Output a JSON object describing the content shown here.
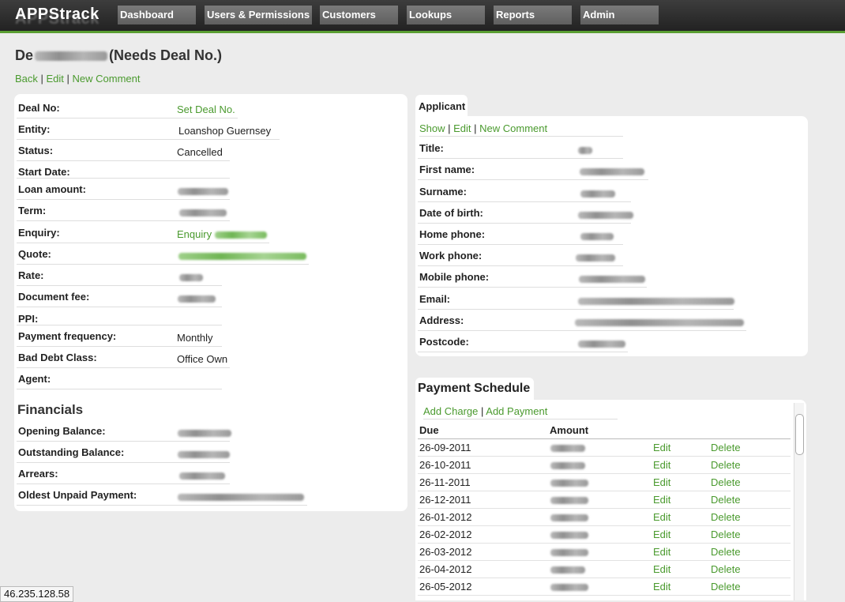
{
  "nav": {
    "logo": "APPStrack",
    "items": [
      "Dashboard",
      "Users & Permissions",
      "Customers",
      "Lookups",
      "Reports",
      "Admin"
    ]
  },
  "page": {
    "title_prefix": "De",
    "title_suffix": "(Needs Deal No.)",
    "actions": {
      "back": "Back",
      "edit": "Edit",
      "new_comment": "New Comment"
    }
  },
  "deal": {
    "labels": {
      "deal_no": "Deal No:",
      "entity": "Entity:",
      "status": "Status:",
      "start_date": "Start Date:",
      "loan_amount": "Loan amount:",
      "term": "Term:",
      "enquiry": "Enquiry:",
      "quote": "Quote:",
      "rate": "Rate:",
      "document_fee": "Document fee:",
      "ppi": "PPI:",
      "payment_frequency": "Payment frequency:",
      "bad_debt_class": "Bad Debt Class:",
      "agent": "Agent:"
    },
    "values": {
      "deal_no": "Set Deal No.",
      "entity": "Loanshop Guernsey",
      "status": "Cancelled",
      "enquiry_prefix": "Enquiry",
      "payment_frequency": "Monthly",
      "bad_debt_class": "Office Own"
    }
  },
  "financials": {
    "heading": "Financials",
    "labels": {
      "opening_balance": "Opening Balance:",
      "outstanding_balance": "Outstanding Balance:",
      "arrears": "Arrears:",
      "oldest_unpaid_payment": "Oldest Unpaid Payment:"
    }
  },
  "applicant": {
    "tab": "Applicant",
    "actions": {
      "show": "Show",
      "edit": "Edit",
      "new_comment": "New Comment"
    },
    "labels": {
      "title": "Title:",
      "first_name": "First name:",
      "surname": "Surname:",
      "date_of_birth": "Date of birth:",
      "home_phone": "Home phone:",
      "work_phone": "Work phone:",
      "mobile_phone": "Mobile phone:",
      "email": "Email:",
      "address": "Address:",
      "postcode": "Postcode:"
    }
  },
  "schedule": {
    "tab": "Payment Schedule",
    "actions": {
      "add_charge": "Add Charge",
      "add_payment": "Add Payment"
    },
    "columns": {
      "due": "Due",
      "amount": "Amount"
    },
    "edit_label": "Edit",
    "delete_label": "Delete",
    "rows": [
      "26-09-2011",
      "26-10-2011",
      "26-11-2011",
      "26-12-2011",
      "26-01-2012",
      "26-02-2012",
      "26-03-2012",
      "26-04-2012",
      "26-05-2012"
    ]
  },
  "status_bar": {
    "ip": "46.235.128.58"
  },
  "colors": {
    "link": "#4a9a2e",
    "nav_accent": "#5a9e32",
    "nav_bg": "#2b2b2b"
  }
}
